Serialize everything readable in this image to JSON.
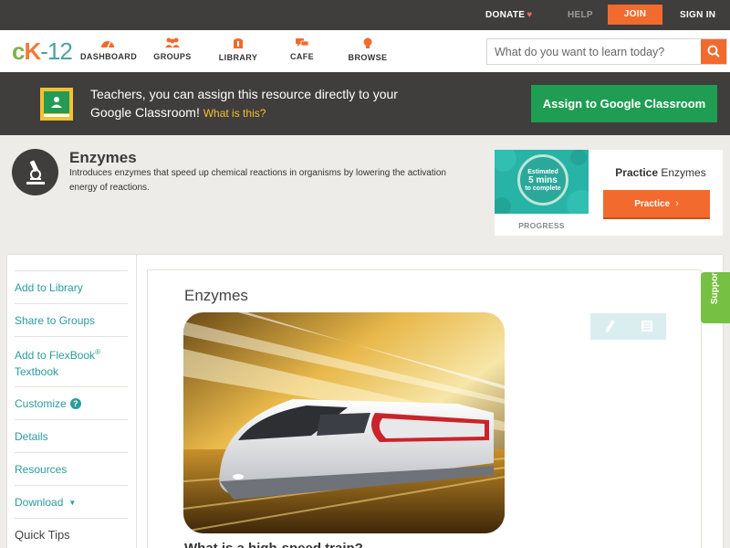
{
  "topbar": {
    "donate": "DONATE",
    "help": "HELP",
    "join": "JOIN",
    "signin": "SIGN IN"
  },
  "logo": {
    "c": "c",
    "k": "K",
    "num": "-12"
  },
  "nav": {
    "dashboard": "DASHBOARD",
    "groups": "GROUPS",
    "library": "LIBRARY",
    "cafe": "CAFE",
    "browse": "BROWSE"
  },
  "search": {
    "placeholder": "What do you want to learn today?"
  },
  "banner": {
    "text": "Teachers, you can assign this resource directly to your Google Classroom!",
    "link": "What is this?",
    "button": "Assign to Google Classroom"
  },
  "concept": {
    "title": "Enzymes",
    "description": "Introduces enzymes that speed up chemical reactions in organisms by lowering the activation energy of reactions."
  },
  "practice": {
    "estimate_line1": "Estimated",
    "estimate_big": "5 mins",
    "estimate_line3": "to complete",
    "progress_label": "PROGRESS",
    "title_bold": "Practice",
    "title_rest": "Enzymes",
    "button": "Practice"
  },
  "sidebar": {
    "add_to_library": "Add to Library",
    "share_to_groups": "Share to Groups",
    "flexbook_1": "Add to FlexBook",
    "flexbook_reg": "®",
    "flexbook_2": "Textbook",
    "customize": "Customize",
    "customize_help": "?",
    "details": "Details",
    "resources": "Resources",
    "download": "Download",
    "quick_tips": "Quick Tips"
  },
  "content": {
    "title": "Enzymes",
    "question": "What is a high-speed train?"
  },
  "support": "Support",
  "colors": {
    "accent_orange": "#f26a2e",
    "teal_link": "#2b9c9c",
    "google_green": "#1f9d52",
    "dark_bar": "#3f3e3c",
    "support_green": "#76c043"
  }
}
